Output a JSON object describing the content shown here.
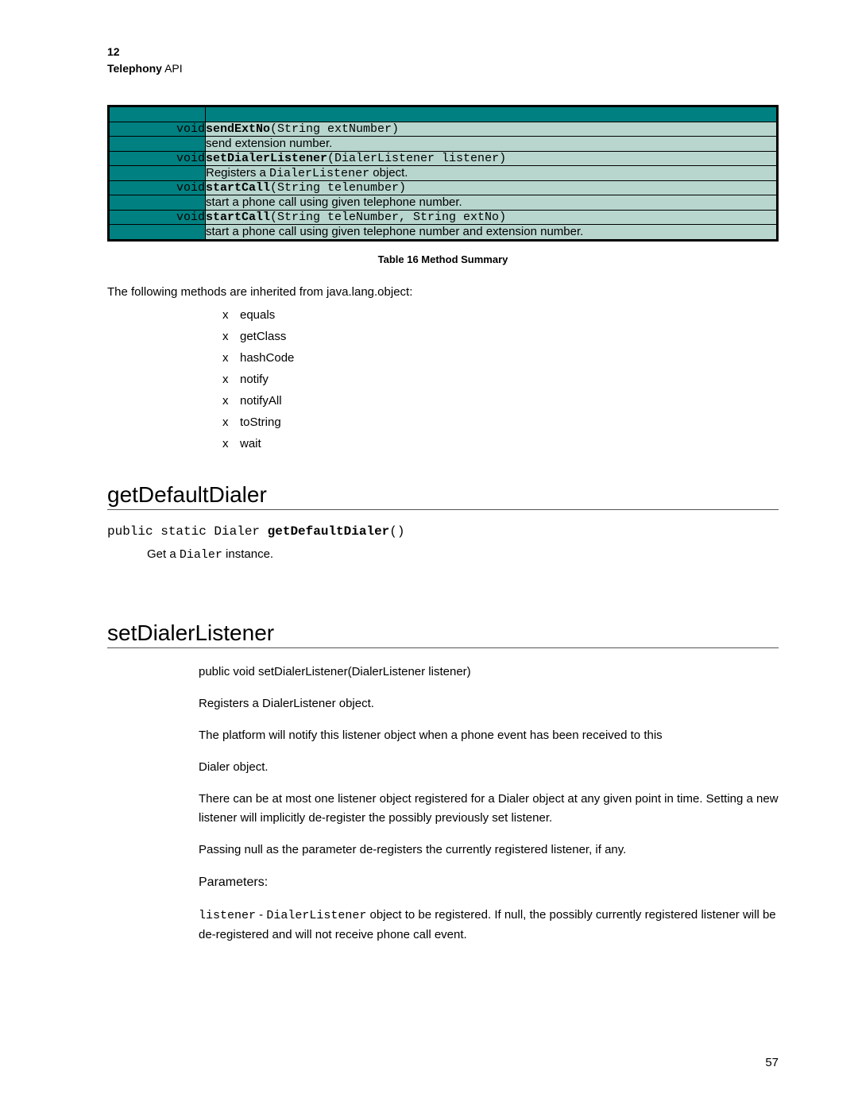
{
  "header": {
    "chapter_num": "12",
    "title_bold": "Telephony",
    "title_rest": " API"
  },
  "method_table": {
    "rows": [
      {
        "ret": "void",
        "sig_bold": "sendExtNo",
        "sig_rest": "(String extNumber)",
        "desc_pre": "send extension number.",
        "desc_mono": "",
        "desc_post": ""
      },
      {
        "ret": "void",
        "sig_bold": "setDialerListener",
        "sig_rest": "(DialerListener listener)",
        "desc_pre": "Registers a ",
        "desc_mono": "DialerListener",
        "desc_post": " object."
      },
      {
        "ret": "void",
        "sig_bold": "startCall",
        "sig_rest": "(String telenumber)",
        "desc_pre": "start a phone call using given telephone number.",
        "desc_mono": "",
        "desc_post": ""
      },
      {
        "ret": "void",
        "sig_bold": "startCall",
        "sig_rest": "(String teleNumber, String extNo)",
        "desc_pre": "start a phone call using given telephone number and extension number.",
        "desc_mono": "",
        "desc_post": ""
      }
    ]
  },
  "table_caption": "Table 16 Method Summary",
  "inherit_intro": "The following methods are inherited from java.lang.object:",
  "inherit_items": [
    "equals",
    "getClass",
    "hashCode",
    "notify",
    "notifyAll",
    "toString",
    "wait"
  ],
  "sections": {
    "getDefaultDialer": {
      "heading": "getDefaultDialer",
      "sig_pre": "public static Dialer ",
      "sig_bold": "getDefaultDialer",
      "sig_post": "()",
      "desc_pre": "Get a ",
      "desc_mono": "Dialer",
      "desc_post": " instance."
    },
    "setDialerListener": {
      "heading": "setDialerListener",
      "lines": {
        "l1": "public void setDialerListener(DialerListener listener)",
        "l2": "Registers a DialerListener object.",
        "l3": "The platform will notify this listener object when a phone event has been received to this",
        "l4": "Dialer object.",
        "l5": "There can be at most one listener object registered for a Dialer object at any given point in time. Setting a new listener will implicitly de-register the possibly previously set listener.",
        "l6": "Passing null as the parameter de-registers the currently registered listener, if any.",
        "param_head": "Parameters:",
        "p_mono1": "listener",
        "p_sep": " - ",
        "p_mono2": "DialerListener",
        "p_rest": " object to be registered. If null, the possibly currently registered listener will be de-registered and will not receive phone call event."
      }
    }
  },
  "page_number": "57"
}
